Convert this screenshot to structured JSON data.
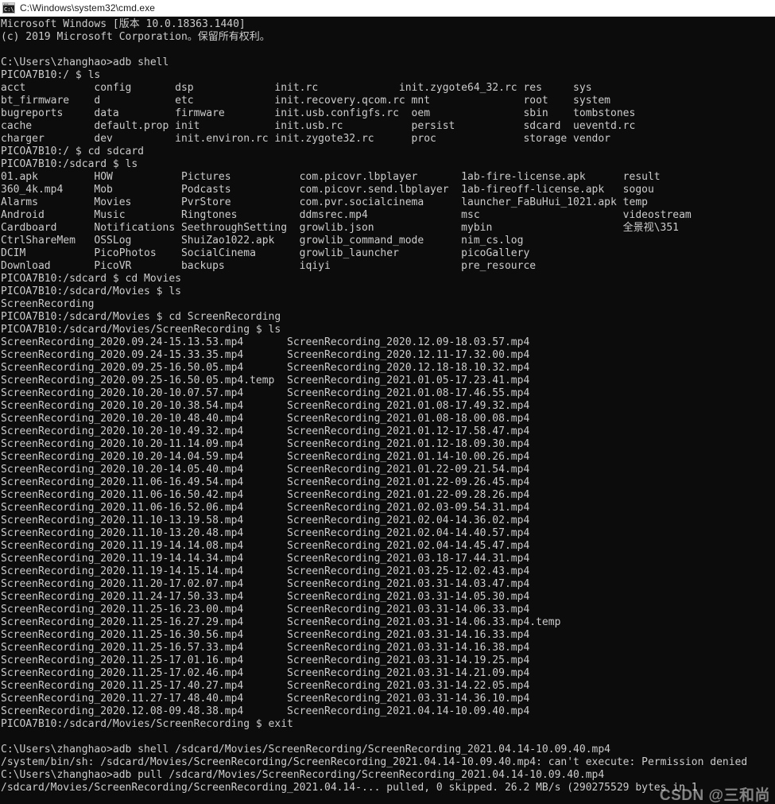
{
  "window": {
    "title": "C:\\Windows\\system32\\cmd.exe",
    "icon": "cmd-console-icon",
    "bg_color": "#0c0c0c",
    "fg_color": "#cccccc",
    "titlebar_bg": "#ffffff",
    "titlebar_fg": "#1a1a1a"
  },
  "watermark": {
    "text": "CSDN @三和尚"
  },
  "console": {
    "lines": [
      "Microsoft Windows [版本 10.0.18363.1440]",
      "(c) 2019 Microsoft Corporation。保留所有权利。",
      "",
      "C:\\Users\\zhanghao>adb shell",
      "PICOA7B10:/ $ ls",
      "acct           config       dsp             init.rc             init.zygote64_32.rc res     sys",
      "bt_firmware    d            etc             init.recovery.qcom.rc mnt               root    system",
      "bugreports     data         firmware        init.usb.configfs.rc  oem               sbin    tombstones",
      "cache          default.prop init            init.usb.rc           persist           sdcard  ueventd.rc",
      "charger        dev          init.environ.rc init.zygote32.rc      proc              storage vendor",
      "PICOA7B10:/ $ cd sdcard",
      "PICOA7B10:/sdcard $ ls",
      "01.apk         HOW           Pictures           com.picovr.lbplayer       1ab-fire-license.apk      result",
      "360_4k.mp4     Mob           Podcasts           com.picovr.send.lbplayer  1ab-fireoff-license.apk   sogou",
      "Alarms         Movies        PvrStore           com.pvr.socialcinema      launcher_FaBuHui_1021.apk temp",
      "Android        Music         Ringtones          ddmsrec.mp4               msc                       videostream",
      "Cardboard      Notifications SeethroughSetting  growlib.json              mybin                     全景视\\351",
      "CtrlShareMem   OSSLog        ShuiZao1022.apk    growlib_command_mode      nim_cs.log",
      "DCIM           PicoPhotos    SocialCinema       growlib_launcher          picoGallery",
      "Download       PicoVR        backups            iqiyi                     pre_resource",
      "PICOA7B10:/sdcard $ cd Movies",
      "PICOA7B10:/sdcard/Movies $ ls",
      "ScreenRecording",
      "PICOA7B10:/sdcard/Movies $ cd ScreenRecording",
      "PICOA7B10:/sdcard/Movies/ScreenRecording $ ls",
      "ScreenRecording_2020.09.24-15.13.53.mp4       ScreenRecording_2020.12.09-18.03.57.mp4",
      "ScreenRecording_2020.09.24-15.33.35.mp4       ScreenRecording_2020.12.11-17.32.00.mp4",
      "ScreenRecording_2020.09.25-16.50.05.mp4       ScreenRecording_2020.12.18-18.10.32.mp4",
      "ScreenRecording_2020.09.25-16.50.05.mp4.temp  ScreenRecording_2021.01.05-17.23.41.mp4",
      "ScreenRecording_2020.10.20-10.07.57.mp4       ScreenRecording_2021.01.08-17.46.55.mp4",
      "ScreenRecording_2020.10.20-10.38.54.mp4       ScreenRecording_2021.01.08-17.49.32.mp4",
      "ScreenRecording_2020.10.20-10.48.40.mp4       ScreenRecording_2021.01.08-18.00.08.mp4",
      "ScreenRecording_2020.10.20-10.49.32.mp4       ScreenRecording_2021.01.12-17.58.47.mp4",
      "ScreenRecording_2020.10.20-11.14.09.mp4       ScreenRecording_2021.01.12-18.09.30.mp4",
      "ScreenRecording_2020.10.20-14.04.59.mp4       ScreenRecording_2021.01.14-10.00.26.mp4",
      "ScreenRecording_2020.10.20-14.05.40.mp4       ScreenRecording_2021.01.22-09.21.54.mp4",
      "ScreenRecording_2020.11.06-16.49.54.mp4       ScreenRecording_2021.01.22-09.26.45.mp4",
      "ScreenRecording_2020.11.06-16.50.42.mp4       ScreenRecording_2021.01.22-09.28.26.mp4",
      "ScreenRecording_2020.11.06-16.52.06.mp4       ScreenRecording_2021.02.03-09.54.31.mp4",
      "ScreenRecording_2020.11.10-13.19.58.mp4       ScreenRecording_2021.02.04-14.36.02.mp4",
      "ScreenRecording_2020.11.10-13.20.48.mp4       ScreenRecording_2021.02.04-14.40.57.mp4",
      "ScreenRecording_2020.11.19-14.14.08.mp4       ScreenRecording_2021.02.04-14.45.47.mp4",
      "ScreenRecording_2020.11.19-14.14.34.mp4       ScreenRecording_2021.03.18-17.44.31.mp4",
      "ScreenRecording_2020.11.19-14.15.14.mp4       ScreenRecording_2021.03.25-12.02.43.mp4",
      "ScreenRecording_2020.11.20-17.02.07.mp4       ScreenRecording_2021.03.31-14.03.47.mp4",
      "ScreenRecording_2020.11.24-17.50.33.mp4       ScreenRecording_2021.03.31-14.05.30.mp4",
      "ScreenRecording_2020.11.25-16.23.00.mp4       ScreenRecording_2021.03.31-14.06.33.mp4",
      "ScreenRecording_2020.11.25-16.27.29.mp4       ScreenRecording_2021.03.31-14.06.33.mp4.temp",
      "ScreenRecording_2020.11.25-16.30.56.mp4       ScreenRecording_2021.03.31-14.16.33.mp4",
      "ScreenRecording_2020.11.25-16.57.33.mp4       ScreenRecording_2021.03.31-14.16.38.mp4",
      "ScreenRecording_2020.11.25-17.01.16.mp4       ScreenRecording_2021.03.31-14.19.25.mp4",
      "ScreenRecording_2020.11.25-17.02.46.mp4       ScreenRecording_2021.03.31-14.21.09.mp4",
      "ScreenRecording_2020.11.25-17.40.27.mp4       ScreenRecording_2021.03.31-14.22.05.mp4",
      "ScreenRecording_2020.11.27-17.48.40.mp4       ScreenRecording_2021.03.31-14.36.10.mp4",
      "ScreenRecording_2020.12.08-09.48.38.mp4       ScreenRecording_2021.04.14-10.09.40.mp4",
      "PICOA7B10:/sdcard/Movies/ScreenRecording $ exit",
      "",
      "C:\\Users\\zhanghao>adb shell /sdcard/Movies/ScreenRecording/ScreenRecording_2021.04.14-10.09.40.mp4",
      "/system/bin/sh: /sdcard/Movies/ScreenRecording/ScreenRecording_2021.04.14-10.09.40.mp4: can't execute: Permission denied",
      "C:\\Users\\zhanghao>adb pull /sdcard/Movies/ScreenRecording/ScreenRecording_2021.04.14-10.09.40.mp4",
      "/sdcard/Movies/ScreenRecording/ScreenRecording_2021.04.14-... pulled, 0 skipped. 26.2 MB/s (290275529 bytes in 1"
    ]
  }
}
